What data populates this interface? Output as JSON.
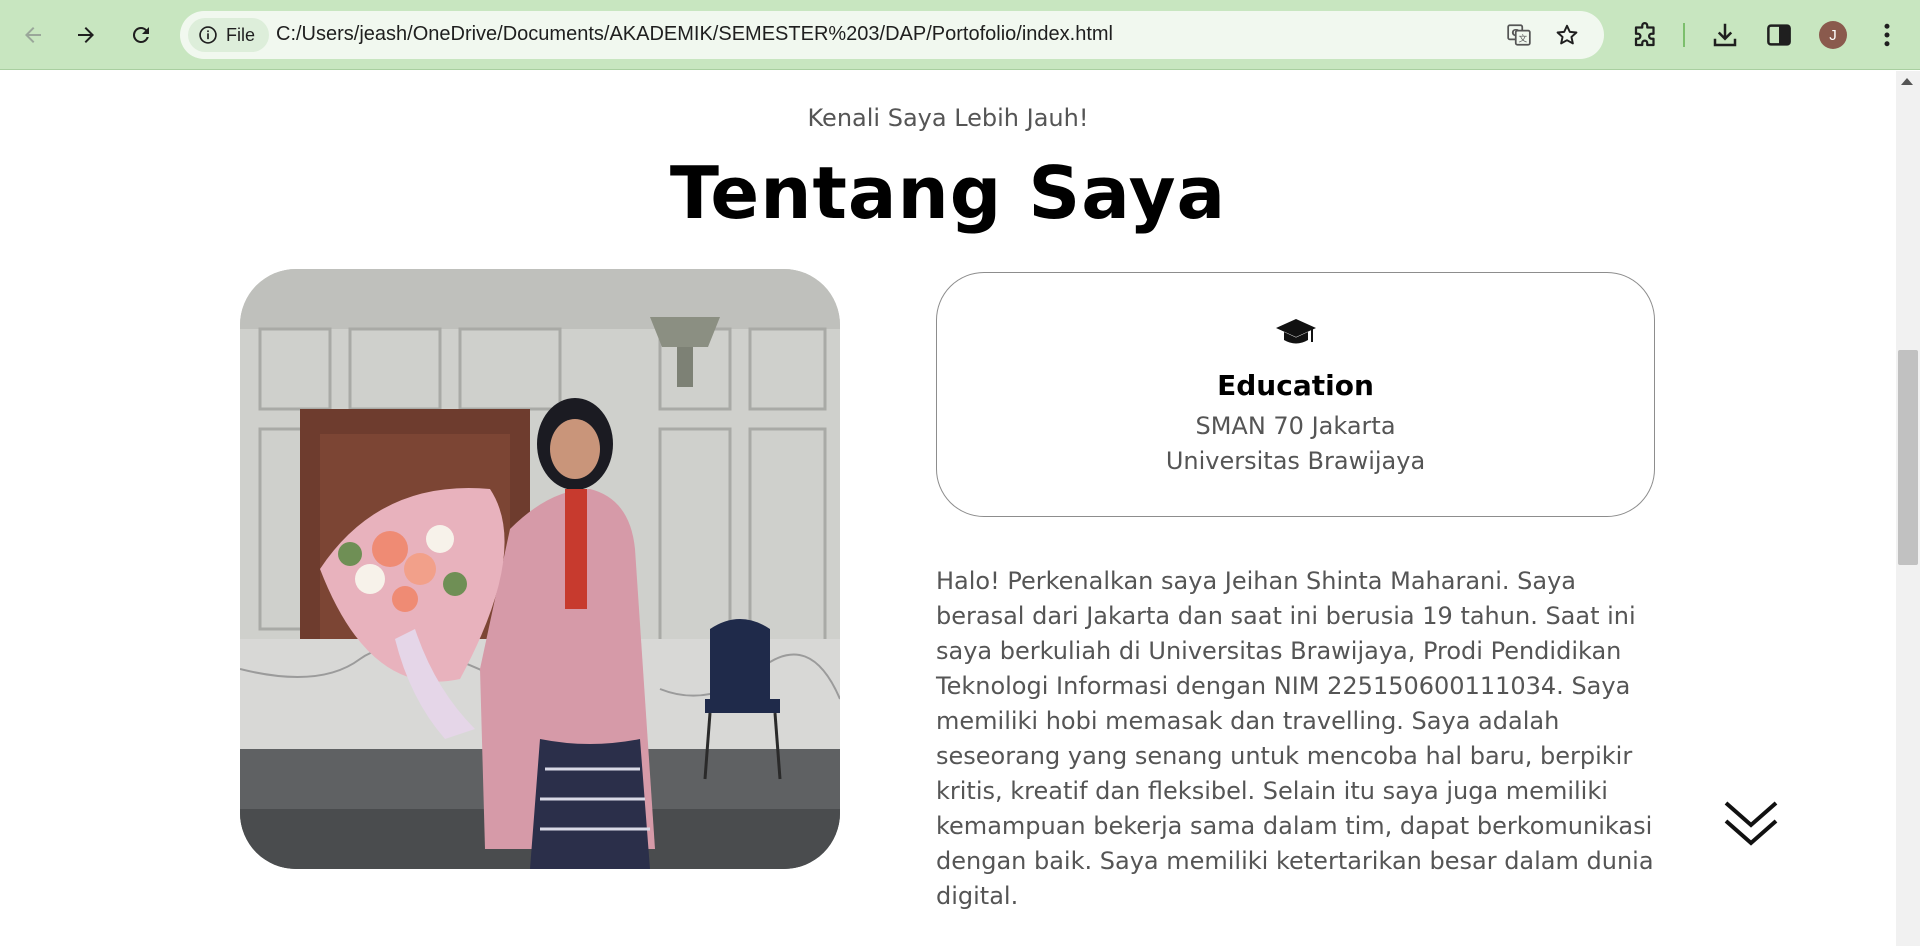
{
  "browser": {
    "file_chip_label": "File",
    "url": "C:/Users/jeash/OneDrive/Documents/AKADEMIK/SEMESTER%203/DAP/Portofolio/index.html",
    "avatar_initial": "J"
  },
  "about": {
    "subtitle": "Kenali Saya Lebih Jauh!",
    "title": "Tentang Saya",
    "education": {
      "heading": "Education",
      "school": "SMAN 70 Jakarta",
      "university": "Universitas Brawijaya"
    },
    "paragraph": "Halo! Perkenalkan saya Jeihan Shinta Maharani. Saya berasal dari Jakarta dan saat ini berusia 19 tahun. Saat ini saya berkuliah di Universitas Brawijaya, Prodi Pendidikan Teknologi Informasi dengan NIM 225150600111034. Saya memiliki hobi memasak dan travelling. Saya adalah seseorang yang senang untuk mencoba hal baru, berpikir kritis, kreatif dan fleksibel. Selain itu saya juga memiliki kemampuan bekerja sama dalam tim, dapat berkomunikasi dengan baik. Saya memiliki ketertarikan besar dalam dunia digital."
  },
  "colors": {
    "chrome_bg": "#c8e6c0",
    "omnibox_bg": "#f1f8ef",
    "text_muted": "#555555",
    "card_border": "#8d8d8d"
  },
  "icons": [
    "back-arrow-icon",
    "forward-arrow-icon",
    "reload-icon",
    "info-icon",
    "translate-icon",
    "bookmark-star-icon",
    "extensions-puzzle-icon",
    "download-icon",
    "side-panel-icon",
    "kebab-menu-icon",
    "graduation-cap-icon",
    "double-chevron-down-icon"
  ]
}
